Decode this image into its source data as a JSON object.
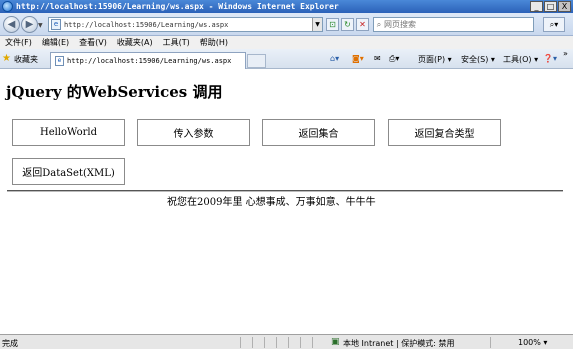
{
  "window": {
    "title": "http://localhost:15906/Learning/ws.aspx - Windows Internet Explorer",
    "minimize": "_",
    "maximize": "□",
    "close": "X"
  },
  "address": {
    "url": "http://localhost:15906/Learning/ws.aspx",
    "search_placeholder": "网页搜索"
  },
  "menu": [
    "文件(F)",
    "编辑(E)",
    "查看(V)",
    "收藏夹(A)",
    "工具(T)",
    "帮助(H)"
  ],
  "favbar": {
    "favorites_label": "收藏夹",
    "tab_title": "http://localhost:15906/Learning/ws.aspx",
    "page_menu": "页面(P) ▾",
    "safety_menu": "安全(S) ▾",
    "tools_menu": "工具(O) ▾",
    "help_menu": "❓▾",
    "more": "»"
  },
  "page": {
    "title": "jQuery 的WebServices 调用",
    "buttons": [
      "HelloWorld",
      "传入参数",
      "返回集合",
      "返回复合类型",
      "返回DataSet(XML)"
    ],
    "message": "祝您在2009年里 心想事成、万事如意、牛牛牛"
  },
  "status": {
    "left": "完成",
    "zone": "本地 Intranet | 保护模式: 禁用",
    "zoom": "100% ▾"
  }
}
